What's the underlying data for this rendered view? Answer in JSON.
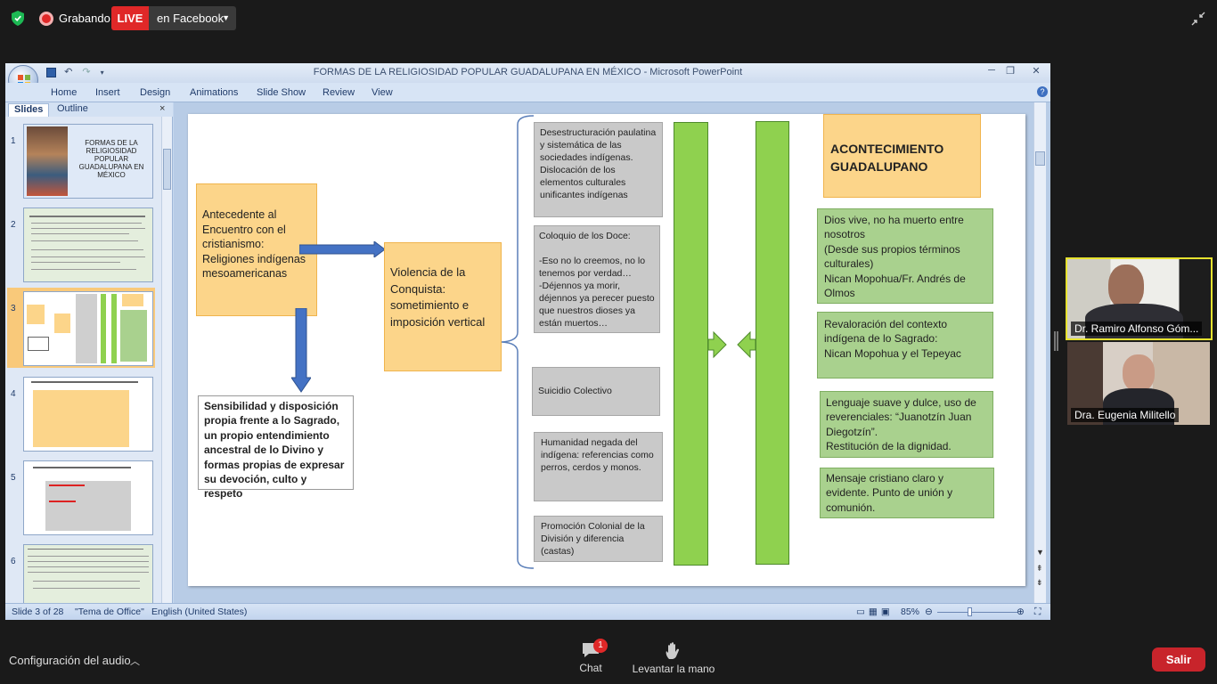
{
  "zoom": {
    "recording_label": "Grabando",
    "live_label": "LIVE",
    "live_destination": "en Facebook",
    "audio_label": "Configuración del audio",
    "chat_label": "Chat",
    "chat_badge": "1",
    "raise_hand_label": "Levantar la mano",
    "exit_label": "Salir",
    "participants": [
      {
        "name": "Dr. Ramiro Alfonso Góm..."
      },
      {
        "name": "Dra. Eugenia Militello"
      }
    ]
  },
  "ppt": {
    "title": "FORMAS DE LA RELIGIOSIDAD POPULAR GUADALUPANA EN MÉXICO - Microsoft PowerPoint",
    "ribbon_tabs": [
      "Home",
      "Insert",
      "Design",
      "Animations",
      "Slide Show",
      "Review",
      "View"
    ],
    "pane_tabs": [
      "Slides",
      "Outline"
    ],
    "thumbnails": [
      {
        "num": "1",
        "text": "FORMAS DE LA RELIGIOSIDAD POPULAR GUADALUPANA EN MÉXICO"
      },
      {
        "num": "2"
      },
      {
        "num": "3"
      },
      {
        "num": "4"
      },
      {
        "num": "5"
      },
      {
        "num": "6"
      }
    ],
    "status": {
      "slide": "Slide 3 of 28",
      "theme": "\"Tema de Office\"",
      "language": "English (United States)",
      "zoom": "85%"
    }
  },
  "slide": {
    "antecedente": "Antecedente al Encuentro con el cristianismo: Religiones indígenas mesoamericanas",
    "sensibilidad": "Sensibilidad y disposición propia frente a lo Sagrado, un propio entendimiento ancestral de lo Divino y formas propias de expresar su devoción, culto y respeto",
    "violencia": "Violencia de la Conquista: sometimiento e imposición vertical",
    "gray_boxes": [
      "Desestructuración paulatina y sistemática de las sociedades indígenas. Dislocación de los elementos culturales unificantes indígenas",
      "Coloquio de los Doce:\n\n-Eso no lo creemos, no lo tenemos por verdad…\n-Déjennos ya morir, déjennos ya perecer puesto que nuestros dioses ya están muertos…",
      "Suicidio Colectivo",
      "Humanidad negada del indígena: referencias como perros, cerdos y monos.",
      "Promoción Colonial de la División y diferencia (castas)"
    ],
    "acontecimiento": "ACONTECIMIENTO GUADALUPANO",
    "green_boxes": [
      "Dios vive, no ha muerto entre nosotros\n(Desde sus propios términos culturales)\nNican Mopohua/Fr. Andrés de Olmos",
      "Revaloración del contexto indígena de lo Sagrado:\nNican Mopohua y el Tepeyac",
      "Lenguaje suave y dulce, uso de reverenciales: “Juanotzín Juan Diegotzín”.\nRestitución de la dignidad.",
      "Mensaje cristiano claro y evidente. Punto de unión y comunión."
    ]
  },
  "colors": {
    "live": "#e02828",
    "exit": "#c8242b",
    "orange_box": "#fcd58a",
    "green_box": "#a9d18e",
    "green_bar": "#8fd14f",
    "arrow_blue": "#4472c4",
    "gray_box": "#c9c9c9"
  }
}
